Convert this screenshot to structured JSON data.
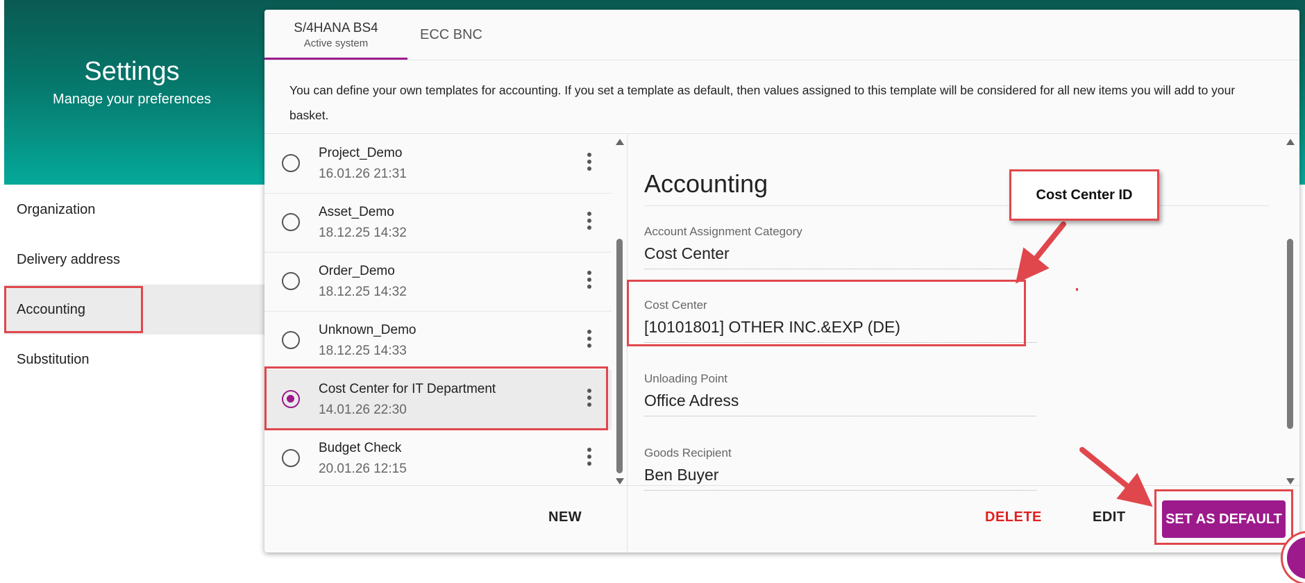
{
  "header": {
    "title": "Settings",
    "subtitle": "Manage your preferences"
  },
  "nav": {
    "items": [
      {
        "label": "Organization",
        "active": false
      },
      {
        "label": "Delivery address",
        "active": false
      },
      {
        "label": "Accounting",
        "active": true
      },
      {
        "label": "Substitution",
        "active": false
      }
    ]
  },
  "tabs": [
    {
      "label": "S/4HANA BS4",
      "sublabel": "Active system",
      "active": true
    },
    {
      "label": "ECC BNC",
      "sublabel": "",
      "active": false
    }
  ],
  "info_text": "You can define your own templates for accounting. If you set a template as default, then values assigned to this template will be considered for all new items you will add to your basket.",
  "templates": [
    {
      "name": "Project_Demo",
      "date": "16.01.26 21:31",
      "selected": false
    },
    {
      "name": "Asset_Demo",
      "date": "18.12.25 14:32",
      "selected": false
    },
    {
      "name": "Order_Demo",
      "date": "18.12.25 14:32",
      "selected": false
    },
    {
      "name": "Unknown_Demo",
      "date": "18.12.25 14:33",
      "selected": false
    },
    {
      "name": "Cost Center for IT Department",
      "date": "14.01.26 22:30",
      "selected": true
    },
    {
      "name": "Budget Check",
      "date": "20.01.26 12:15",
      "selected": false
    }
  ],
  "detail": {
    "title": "Accounting",
    "fields": [
      {
        "label": "Account Assignment Category",
        "value": "Cost Center"
      },
      {
        "label": "Cost Center",
        "value": "[10101801] OTHER INC.&EXP (DE)"
      },
      {
        "label": "Unloading Point",
        "value": "Office Adress"
      },
      {
        "label": "Goods Recipient",
        "value": "Ben Buyer"
      }
    ]
  },
  "actions": {
    "new": "NEW",
    "delete": "DELETE",
    "edit": "EDIT",
    "set_default": "SET AS DEFAULT"
  },
  "callout": {
    "label": "Cost Center ID"
  },
  "colors": {
    "brand": "#9c1a8c",
    "teal": "#05a99a",
    "annotation": "#e0474c",
    "delete": "#e0201f"
  }
}
